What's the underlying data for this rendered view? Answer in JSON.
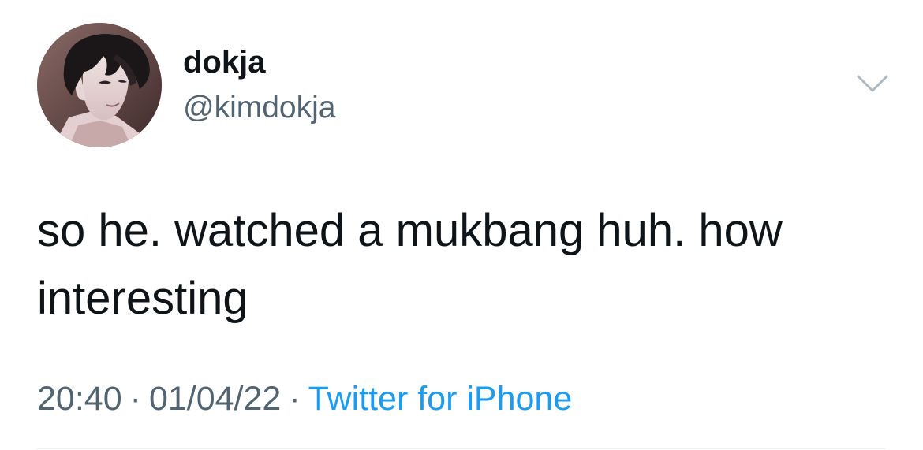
{
  "tweet": {
    "display_name": "dokja",
    "handle": "@kimdokja",
    "text": "so he. watched a mukbang huh. how interesting",
    "time": "20:40",
    "date": "01/04/22",
    "separator": "·",
    "source": "Twitter for iPhone"
  },
  "icons": {
    "avatar": "profile-avatar",
    "menu": "chevron-down-icon"
  },
  "colors": {
    "text_primary": "#0f1419",
    "text_secondary": "#536471",
    "link": "#1d9bf0",
    "divider": "#eff3f4"
  }
}
